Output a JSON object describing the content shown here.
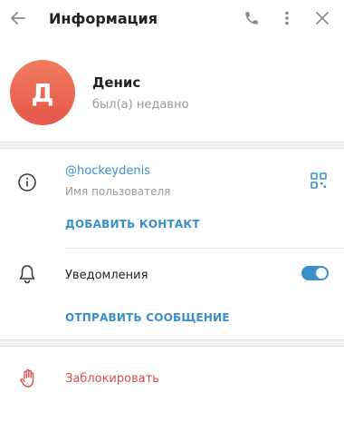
{
  "header": {
    "title": "Информация",
    "back_icon": "arrow-left-icon",
    "call_icon": "phone-icon",
    "more_icon": "more-vertical-icon",
    "close_icon": "close-icon"
  },
  "profile": {
    "avatar_letter": "Д",
    "avatar_color": "#e8604f",
    "name": "Денис",
    "status": "был(а) недавно"
  },
  "info": {
    "username": "@hockeydenis",
    "username_caption": "Имя пользователя",
    "add_contact_label": "ДОБАВИТЬ КОНТАКТ",
    "info_icon": "info-icon",
    "qr_icon": "qr-code-icon"
  },
  "notifications": {
    "label": "Уведомления",
    "enabled": true,
    "bell_icon": "bell-icon",
    "send_message_label": "ОТПРАВИТЬ СООБЩЕНИЕ"
  },
  "block": {
    "label": "Заблокировать",
    "icon": "hand-stop-icon",
    "color": "#d64e4e"
  },
  "colors": {
    "accent": "#3a8fc9",
    "danger": "#d64e4e"
  }
}
